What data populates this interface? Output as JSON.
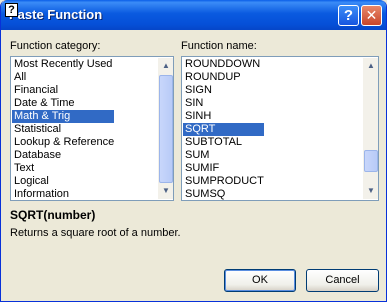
{
  "window": {
    "title": "Paste Function",
    "help_glyph": "?",
    "close_glyph": "✕"
  },
  "category": {
    "label": "Function category:",
    "items": [
      "Most Recently Used",
      "All",
      "Financial",
      "Date & Time",
      "Math & Trig",
      "Statistical",
      "Lookup & Reference",
      "Database",
      "Text",
      "Logical",
      "Information"
    ],
    "selected": "Math & Trig"
  },
  "function_name": {
    "label": "Function name:",
    "items": [
      "ROUNDDOWN",
      "ROUNDUP",
      "SIGN",
      "SIN",
      "SINH",
      "SQRT",
      "SUBTOTAL",
      "SUM",
      "SUMIF",
      "SUMPRODUCT",
      "SUMSQ"
    ],
    "selected": "SQRT"
  },
  "syntax": "SQRT(number)",
  "description": "Returns a square root of a number.",
  "buttons": {
    "ok": "OK",
    "cancel": "Cancel"
  },
  "icons": {
    "help": "help-question-icon",
    "close": "close-x-icon",
    "office_assistant": "office-assistant-icon",
    "up": "▲",
    "down": "▼"
  },
  "colors": {
    "selection": "#316ac5",
    "titlebar": "#0550d8"
  }
}
